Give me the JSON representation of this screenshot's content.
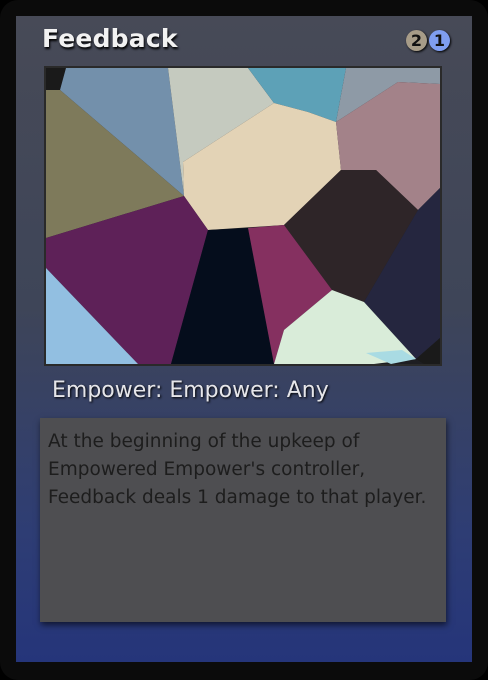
{
  "card": {
    "name": "Feedback",
    "mana_cost": [
      {
        "symbol": "2",
        "color": "#a79c88",
        "icon": "generic-mana-2"
      },
      {
        "symbol": "1",
        "color": "#7f9ef0",
        "icon": "blue-mana-1"
      }
    ],
    "type_line": "Empower: Empower: Any",
    "rules_text": "At the beginning of the upkeep of Empowered Empower's controller, Feedback deals 1 damage to that player."
  }
}
